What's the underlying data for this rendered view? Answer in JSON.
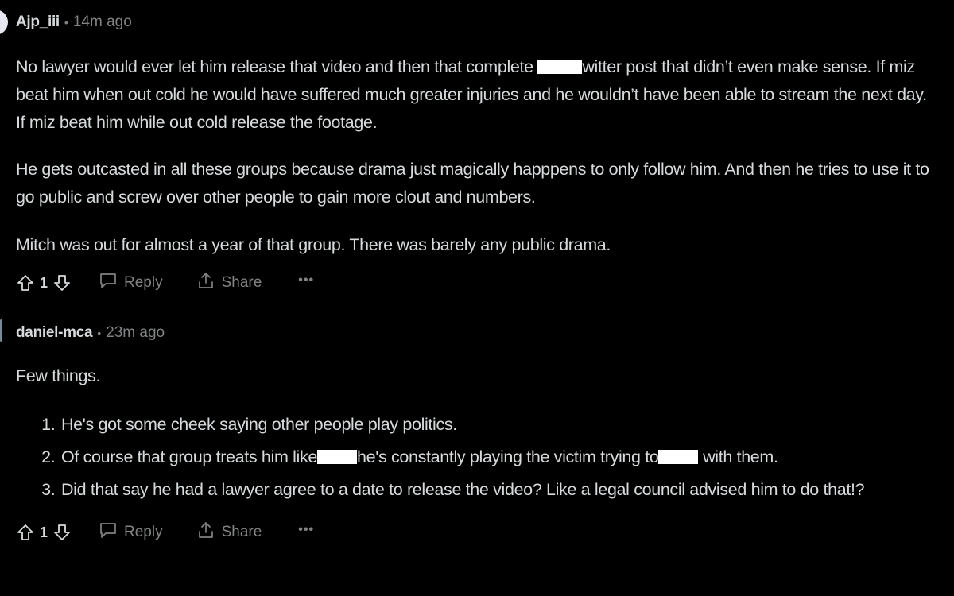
{
  "comments": [
    {
      "author": "Ajp_iii",
      "time": "14m ago",
      "paragraphs": {
        "p1_a": "No lawyer would ever let him release that video and then that complete ",
        "p1_b": "witter post that didn’t even make sense. If miz beat him when out cold he would have suffered much greater injuries and he wouldn’t have been able to stream the next day. If miz beat him while out cold release the footage.",
        "p2": "He gets outcasted in all these groups because drama just magically happpens to only follow him. And then he tries to use it to go public and screw over other people to gain more clout and numbers.",
        "p3": "Mitch was out for almost a year of that group. There was barely any public drama."
      },
      "votes": "1",
      "reply_label": "Reply",
      "share_label": "Share",
      "more_label": "•••"
    },
    {
      "author": "daniel-mca",
      "time": "23m ago",
      "intro": "Few things.",
      "items": {
        "i1": "He's got some cheek saying other people play politics.",
        "i2_a": "Of course that group treats him like",
        "i2_b": "he's constantly playing the victim trying to",
        "i2_c": " with them.",
        "i3": "Did that say he had a lawyer agree to a date to release the video? Like a legal council advised him to do that!?"
      },
      "votes": "1",
      "reply_label": "Reply",
      "share_label": "Share",
      "more_label": "•••"
    }
  ],
  "colors": {
    "background": "#000000",
    "text": "#d7dadc",
    "muted": "#818384",
    "redaction": "#ffffff",
    "thread_line": "#7a8a99"
  },
  "icons": [
    "upvote-icon",
    "downvote-icon",
    "reply-icon",
    "share-icon",
    "more-icon"
  ]
}
